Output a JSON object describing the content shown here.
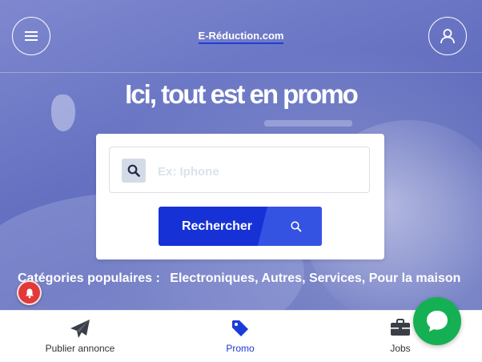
{
  "header": {
    "brand": "E-Réduction.com",
    "menu_icon": "hamburger-menu-icon",
    "user_icon": "user-icon"
  },
  "hero": {
    "headline": "Ici, tout est en promo"
  },
  "search": {
    "placeholder": "Ex: Iphone",
    "value": "",
    "button_label": "Rechercher",
    "icon": "search-icon"
  },
  "categories": {
    "label": "Catégories populaires :",
    "items": [
      "Electroniques,",
      "Autres,",
      "Services,",
      "Pour la maison"
    ]
  },
  "bottom_nav": {
    "items": [
      {
        "label": "Publier annonce",
        "icon": "paper-plane-icon"
      },
      {
        "label": "Promo",
        "icon": "tag-icon",
        "active": true
      },
      {
        "label": "Jobs",
        "icon": "briefcase-icon"
      }
    ]
  },
  "colors": {
    "accent": "#1632d6",
    "chat": "#15b054",
    "notification": "#e23939"
  }
}
